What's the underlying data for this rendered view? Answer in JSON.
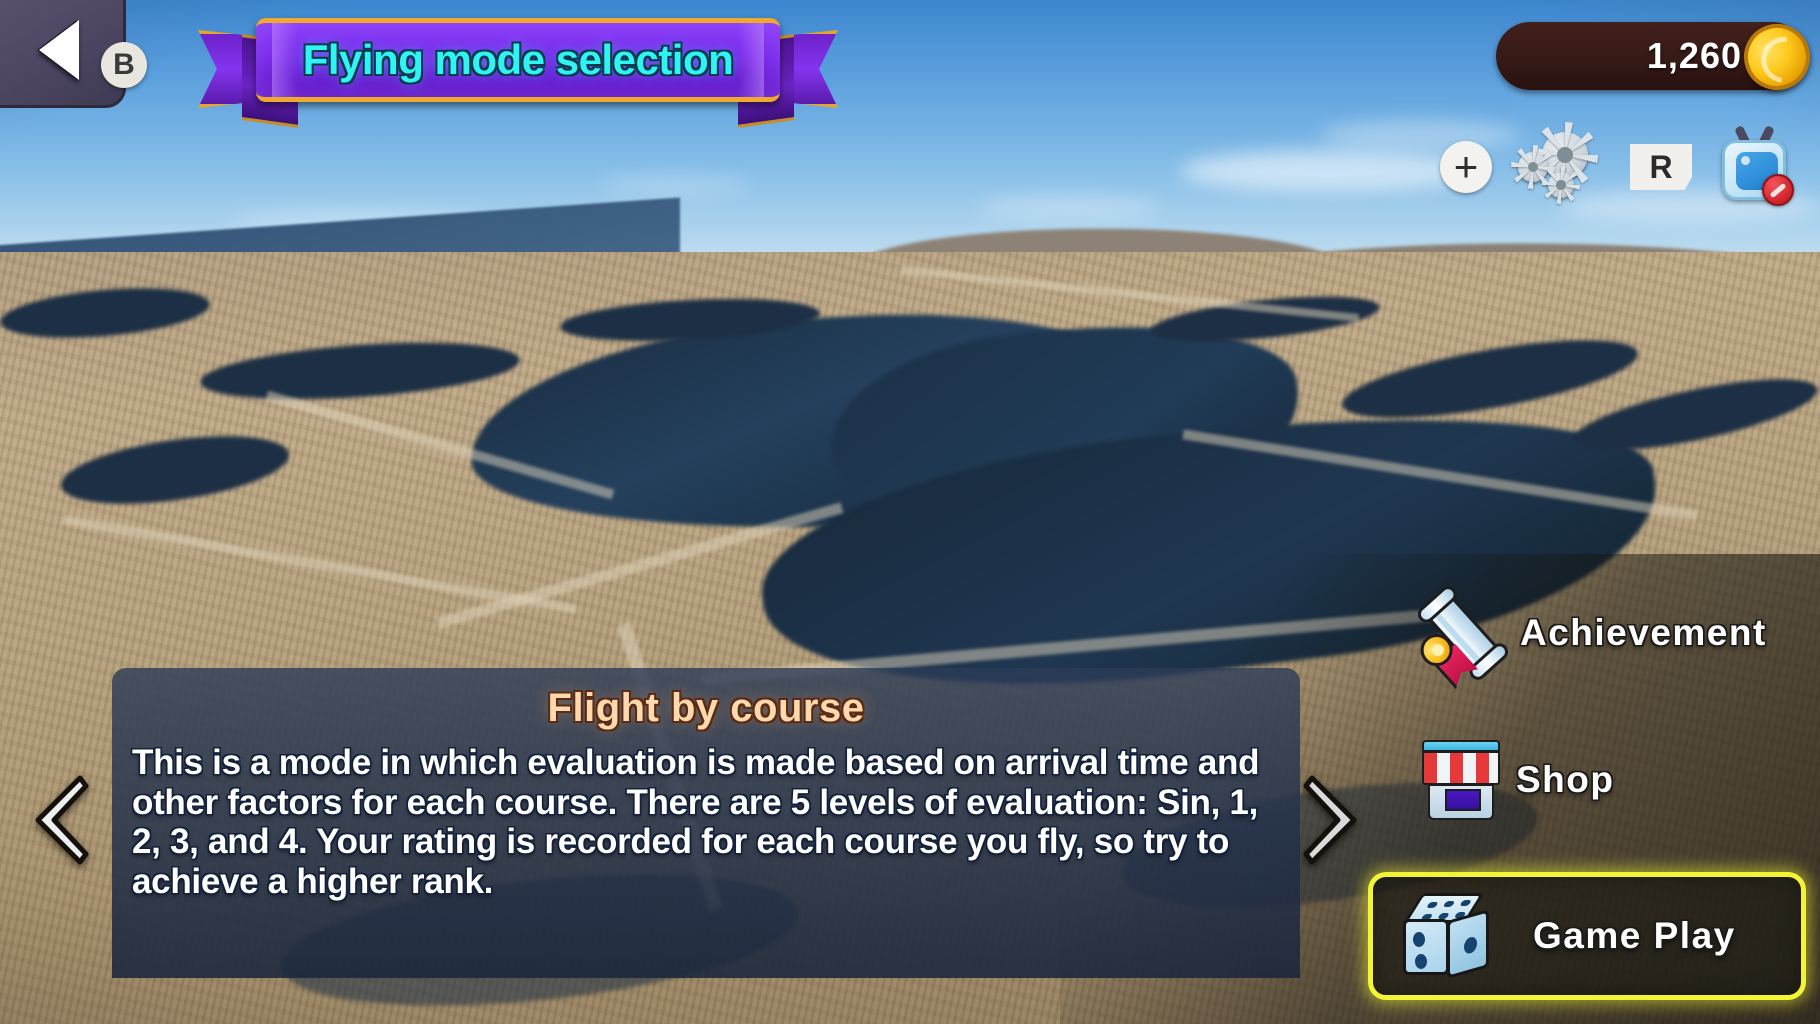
{
  "header": {
    "back_button": {
      "icon": "triangle-left-icon",
      "key_hint": "B"
    },
    "banner_title": "Flying mode selection",
    "currency": {
      "amount": "1,260",
      "icon": "gold-coin-icon"
    }
  },
  "toolbar": {
    "items": [
      {
        "name": "add-button",
        "icon": "plus-icon",
        "label": "+"
      },
      {
        "name": "settings-button",
        "icon": "gears-icon",
        "label": ""
      },
      {
        "name": "reset-key-hint",
        "icon": "keycap-icon",
        "label": "R"
      },
      {
        "name": "no-ads-button",
        "icon": "tv-blocked-icon",
        "label": ""
      }
    ]
  },
  "description": {
    "title": "Flight by course",
    "body": "This is a mode in which evaluation is made based on arrival time and other factors for each course. There are 5 levels of evaluation: Sin, 1, 2, 3, and 4. Your rating is recorded for each course you fly, so try to achieve a higher rank."
  },
  "carousel": {
    "prev_icon": "chevron-left-icon",
    "next_icon": "chevron-right-icon"
  },
  "menu": {
    "items": [
      {
        "label": "Achievement",
        "icon": "diploma-scroll-icon",
        "selected": false
      },
      {
        "label": "Shop",
        "icon": "storefront-icon",
        "selected": false
      },
      {
        "label": "Game Play",
        "icon": "dice-icon",
        "selected": true
      }
    ]
  },
  "theme": {
    "banner_fill": "#7a2bea",
    "banner_edge": "#f0a82e",
    "banner_text": "#2ff4f4",
    "coin_bar_fill": "#361a16",
    "coin_gold": "#fdc91c",
    "desc_panel_fill": "rgba(34,48,74,0.84)",
    "desc_title_color": "#ffd9ae",
    "selection_glow": "#f4f436"
  }
}
